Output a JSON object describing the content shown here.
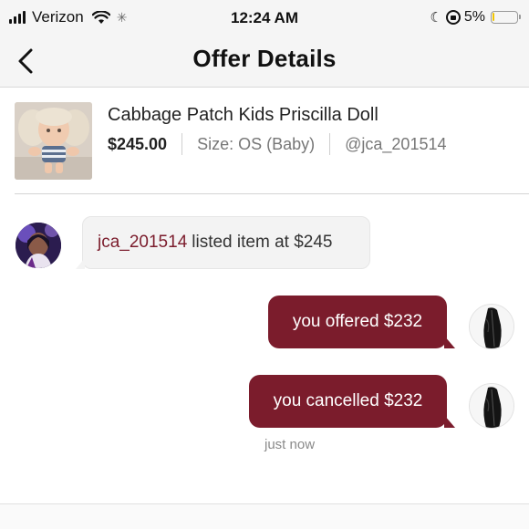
{
  "status_bar": {
    "carrier": "Verizon",
    "time": "12:24 AM",
    "battery_percent": "5%",
    "battery_level": 0.05,
    "icons": [
      "signal-icon",
      "wifi-icon",
      "spinner-icon",
      "moon-icon",
      "rotation-lock-icon",
      "battery-icon"
    ]
  },
  "nav": {
    "back_icon": "chevron-left-icon",
    "title": "Offer Details"
  },
  "item": {
    "title": "Cabbage Patch Kids Priscilla Doll",
    "price": "$245.00",
    "size": "Size: OS (Baby)",
    "seller": "@jca_201514"
  },
  "messages": [
    {
      "type": "system",
      "handle": "jca_201514",
      "text": "listed item at $245"
    },
    {
      "type": "outgoing",
      "text": "you offered $232"
    },
    {
      "type": "outgoing",
      "text": "you cancelled $232"
    }
  ],
  "timestamp": "just now",
  "colors": {
    "accent": "#7b1c2c",
    "bubble_gray": "#f3f3f3",
    "battery_low": "#f2c500"
  }
}
